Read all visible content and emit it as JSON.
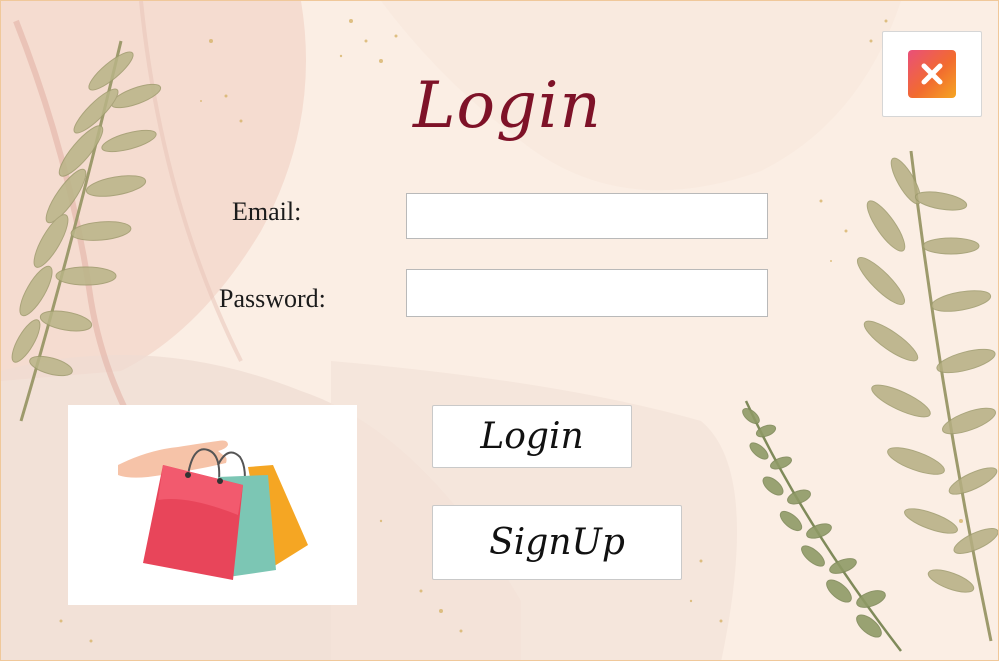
{
  "window": {
    "title": "Login"
  },
  "form": {
    "email_label": "Email:",
    "email_value": "",
    "password_label": "Password:",
    "password_value": ""
  },
  "buttons": {
    "login_label": "Login",
    "signup_label": "SignUp",
    "close_icon": "close-icon"
  },
  "image": {
    "icon": "shopping-bags-illustration"
  },
  "colors": {
    "title": "#7e1228",
    "close_gradient_start": "#e94f7a",
    "close_gradient_end": "#f5a623",
    "background": "#fbeee4",
    "fern": "#9a9a6a"
  }
}
